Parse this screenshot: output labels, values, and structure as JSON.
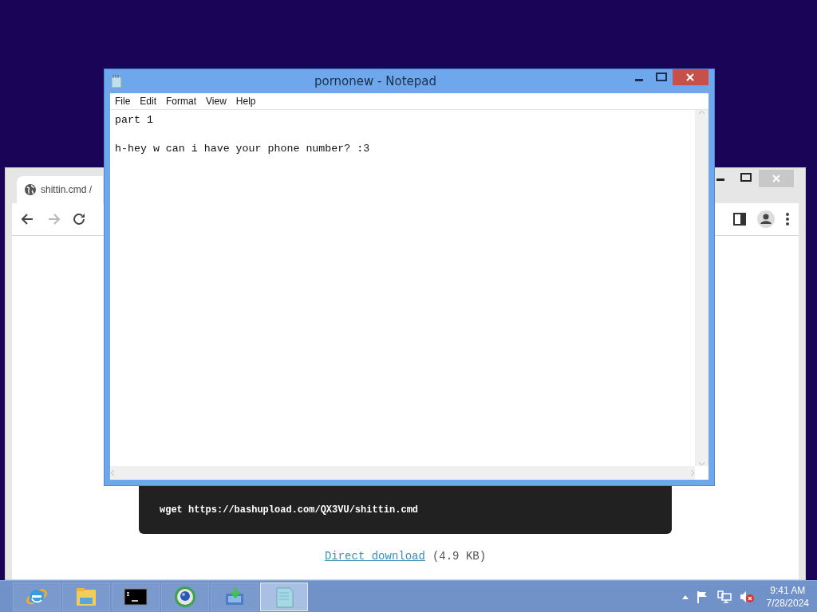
{
  "browser": {
    "tab": {
      "title": "shittin.cmd /"
    },
    "nav_buttons": [
      {
        "kind": "back",
        "disabled": false
      },
      {
        "kind": "forward",
        "disabled": true
      },
      {
        "kind": "reload",
        "disabled": false
      }
    ],
    "command": "wget https://bashupload.com/QX3VU/shittin.cmd",
    "download_link": "Direct download",
    "file_size": "(4.9 KB)"
  },
  "notepad": {
    "title": "pornonew - Notepad",
    "menu": [
      "File",
      "Edit",
      "Format",
      "View",
      "Help"
    ],
    "text": "part 1\n\nh-hey w can i have your phone number? :3"
  },
  "taskbar": {
    "apps": [
      {
        "kind": "ie",
        "selected": false
      },
      {
        "kind": "explorer",
        "selected": false
      },
      {
        "kind": "console",
        "selected": false
      },
      {
        "kind": "globe",
        "selected": false
      },
      {
        "kind": "installer",
        "selected": false
      },
      {
        "kind": "notepad",
        "selected": true
      }
    ],
    "clock": {
      "time": "9:41 AM",
      "date": "7/28/2024"
    }
  }
}
